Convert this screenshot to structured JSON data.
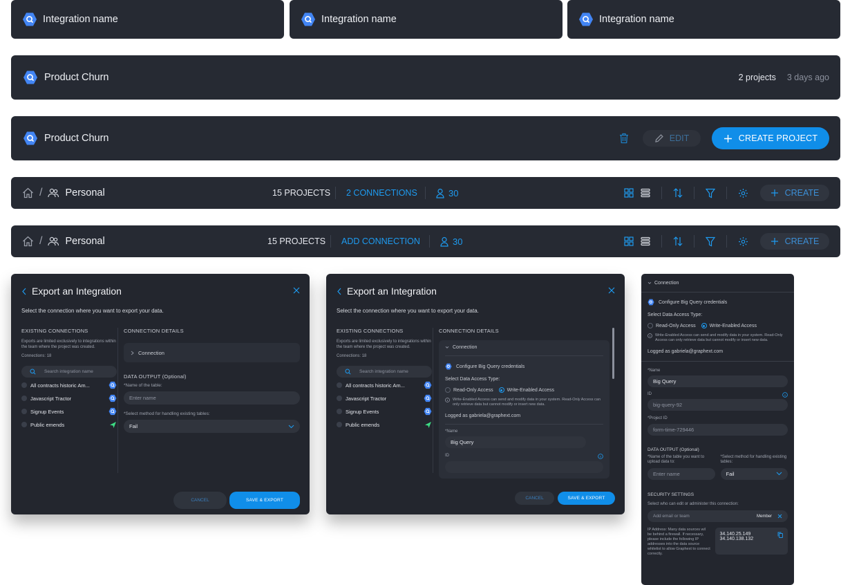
{
  "colors": {
    "card_bg": "#262a33",
    "accent": "#108ee9",
    "link": "#1e9bf0",
    "brand_icon": "#4285f4",
    "send_icon": "#3ddc84"
  },
  "integration_tiles": [
    {
      "label": "Integration name"
    },
    {
      "label": "Integration name"
    },
    {
      "label": "Integration name"
    }
  ],
  "project_row": {
    "title": "Product Churn",
    "projects": "2 projects",
    "updated": "3 days ago"
  },
  "project_header": {
    "title": "Product Churn",
    "edit_label": "EDIT",
    "create_label": "CREATE PROJECT",
    "icons": [
      "trash-icon",
      "pencil-icon",
      "plus-icon"
    ]
  },
  "toolbar1": {
    "breadcrumb": "Personal",
    "projects": "15 PROJECTS",
    "connections": "2 CONNECTIONS",
    "members": "30",
    "create_label": "CREATE"
  },
  "toolbar2": {
    "breadcrumb": "Personal",
    "projects": "15 PROJECTS",
    "connections": "ADD CONNECTION",
    "members": "30",
    "create_label": "CREATE"
  },
  "dialog1": {
    "title": "Export an Integration",
    "subtitle": "Select the connection where you want to export your data.",
    "existing_header": "EXISTING CONNECTIONS",
    "existing_note": "Exports are limited exclusively to integrations within the team where the project was created.",
    "connections_count": "Connections: 18",
    "search_placeholder": "Search integration name",
    "connections": [
      {
        "name": "All contracts historic Am...",
        "icon": "bigquery-icon"
      },
      {
        "name": "Javascript Tractor",
        "icon": "bigquery-icon"
      },
      {
        "name": "Signup Events",
        "icon": "bigquery-icon"
      },
      {
        "name": "Public emends",
        "icon": "send-icon"
      }
    ],
    "details_header": "CONNECTION DETAILS",
    "connection_label": "Connection",
    "data_output": "DATA OUTPUT (Optional)",
    "table_label": "*Name of the table:",
    "table_placeholder": "Enter name",
    "method_label": "*Select method for handling existing tables:",
    "method_value": "Fail",
    "cancel": "CANCEL",
    "save": "SAVE & EXPORT"
  },
  "dialog2": {
    "title": "Export an Integration",
    "subtitle": "Select the connection where you want to export your data.",
    "existing_header": "EXISTING CONNECTIONS",
    "existing_note": "Exports are limited exclusively to integrations within the team where the project was created.",
    "connections_count": "Connections: 18",
    "search_placeholder": "Search integration name",
    "connections": [
      {
        "name": "All contracts historic Am...",
        "icon": "bigquery-icon"
      },
      {
        "name": "Javascript Tractor",
        "icon": "bigquery-icon"
      },
      {
        "name": "Signup Events",
        "icon": "bigquery-icon"
      },
      {
        "name": "Public emends",
        "icon": "send-icon"
      }
    ],
    "details_header": "CONNECTION DETAILS",
    "connection_label": "Connection",
    "configure": "Configure Big Query credentials",
    "access_type": "Select Data Access Type:",
    "read_only": "Read-Only Access",
    "write_enabled": "Write-Enabled Access",
    "access_note": "Write-Enabled Access can send and modify data in your system. Read-Only Access can only retrieve data but cannot modify or insert new data.",
    "logged_as": "Logged as gabriela@graphext.com",
    "name_label": "*Name",
    "name_value": "Big Query",
    "id_label": "ID",
    "cancel": "CANCEL",
    "save": "SAVE & EXPORT"
  },
  "panel3": {
    "connection_label": "Connection",
    "configure": "Configure Big Query credentials",
    "access_type": "Select Data Access Type:",
    "read_only": "Read-Only Access",
    "write_enabled": "Write-Enabled Access",
    "access_note": "Write-Enabled Access can send and modify data in your system. Read-Only Access can only retrieve data but cannot modify or insert new data.",
    "logged_as": "Logged as gabriela@graphext.com",
    "name_label": "*Name",
    "name_value": "Big Query",
    "id_label": "ID",
    "id_value": "big-query-92",
    "project_id_label": "*Project ID",
    "project_id_value": "form-time-729446",
    "data_output": "DATA OUTPUT (Optional)",
    "table_label": "*Name of the table you want to upload data to:",
    "method_label": "*Select method for handling existing tables:",
    "table_placeholder": "Enter name",
    "method_value": "Fail",
    "security": "SECURITY SETTINGS",
    "security_note": "Select who can edit or administer this connection:",
    "email_placeholder": "Add email  or team",
    "role": "Member",
    "ip_note": "IP Address: Many data sources wil be behind a firewall. If necessary, please include the following IP addresses into the data source whitelist to allow Graphext to connect correctly.",
    "ip1": "34.140.25.149",
    "ip2": "34.140.138.132"
  }
}
